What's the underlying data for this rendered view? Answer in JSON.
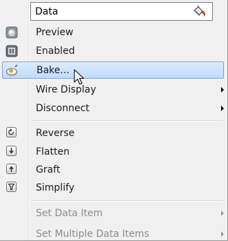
{
  "name_field": {
    "value": "Data"
  },
  "menu": {
    "preview": "Preview",
    "enabled": "Enabled",
    "bake": "Bake...",
    "wire_display": "Wire Display",
    "disconnect": "Disconnect",
    "reverse": "Reverse",
    "flatten": "Flatten",
    "graft": "Graft",
    "simplify": "Simplify",
    "set_data_item": "Set Data Item",
    "set_multiple_data_items": "Set Multiple Data Items"
  },
  "icons": {
    "name_field_icon": "paint-brush-icon",
    "preview": "preview-sphere-icon",
    "enabled": "enabled-icon",
    "bake": "bake-egg-icon",
    "reverse": "reverse-icon",
    "flatten": "flatten-arrow-down-icon",
    "graft": "graft-arrow-up-icon",
    "simplify": "simplify-funnel-icon"
  },
  "colors": {
    "hover_fill": "#c8defb",
    "hover_border": "#7da2ce",
    "disabled_text": "#8c8c8c"
  }
}
